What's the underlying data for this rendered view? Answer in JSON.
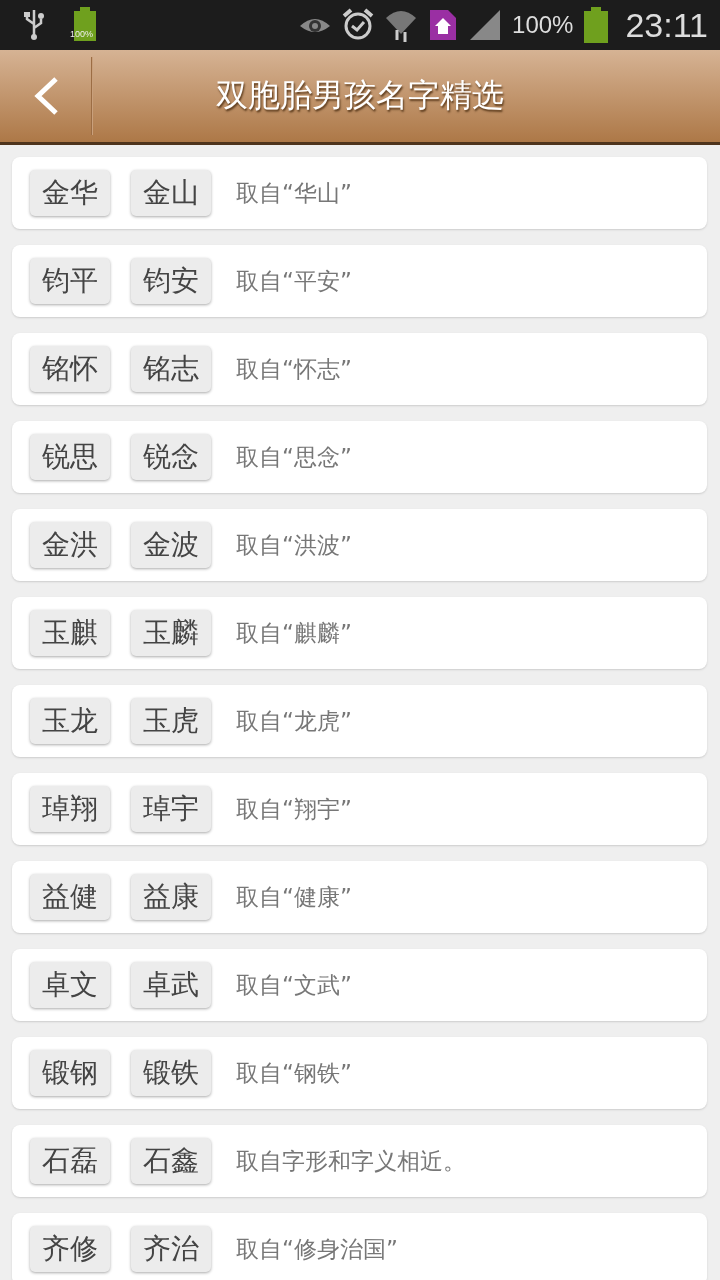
{
  "status_bar": {
    "usb_battery_label": "100%",
    "battery_percent": "100%",
    "time": "23:11"
  },
  "header": {
    "title": "双胞胎男孩名字精选"
  },
  "items": [
    {
      "names": [
        "金华",
        "金山"
      ],
      "note": "取自“华山”"
    },
    {
      "names": [
        "钧平",
        "钧安"
      ],
      "note": "取自“平安”"
    },
    {
      "names": [
        "铭怀",
        "铭志"
      ],
      "note": "取自“怀志”"
    },
    {
      "names": [
        "锐思",
        "锐念"
      ],
      "note": "取自“思念”"
    },
    {
      "names": [
        "金洪",
        "金波"
      ],
      "note": "取自“洪波”"
    },
    {
      "names": [
        "玉麒",
        "玉麟"
      ],
      "note": "取自“麒麟”"
    },
    {
      "names": [
        "玉龙",
        "玉虎"
      ],
      "note": "取自“龙虎”"
    },
    {
      "names": [
        "琸翔",
        "琸宇"
      ],
      "note": "取自“翔宇”"
    },
    {
      "names": [
        "益健",
        "益康"
      ],
      "note": "取自“健康”"
    },
    {
      "names": [
        "卓文",
        "卓武"
      ],
      "note": "取自“文武”"
    },
    {
      "names": [
        "锻钢",
        "锻铁"
      ],
      "note": "取自“钢铁”"
    },
    {
      "names": [
        "石磊",
        "石鑫"
      ],
      "note": "取自字形和字义相近。"
    },
    {
      "names": [
        "齐修",
        "齐治"
      ],
      "note": "取自“修身治国”"
    }
  ]
}
